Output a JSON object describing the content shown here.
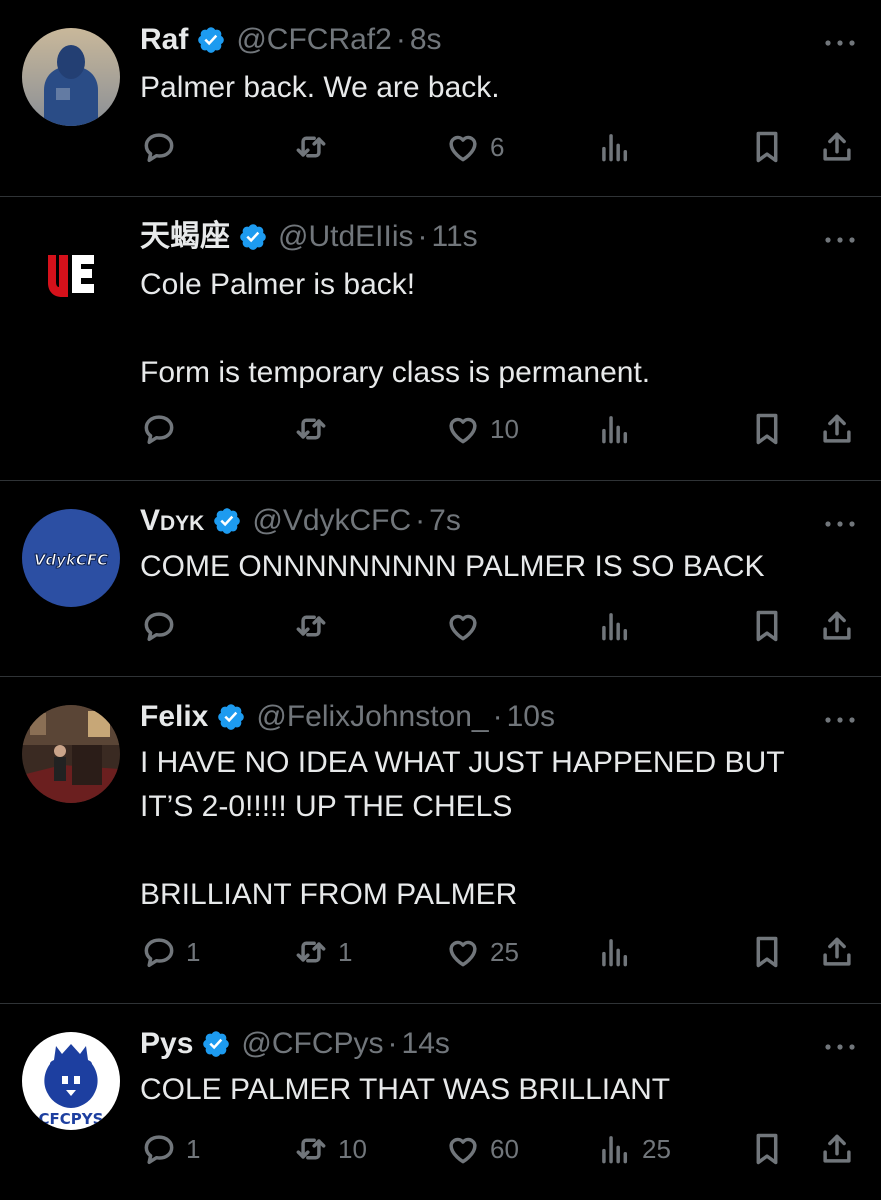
{
  "colors": {
    "background": "#000000",
    "text": "#e7e9ea",
    "muted": "#71767b",
    "verified": "#1d9bf0",
    "divider": "#2f3336"
  },
  "tweets": [
    {
      "name": "Raf",
      "handle": "@CFCRaf2",
      "sep": "·",
      "time": "8s",
      "text": "Palmer back. We are back.",
      "replies": "",
      "reposts": "",
      "likes": "6",
      "views": ""
    },
    {
      "name": "天蝎座",
      "handle": "@UtdEIIis",
      "sep": "·",
      "time": "11s",
      "text": "Cole Palmer is back!\n\nForm is temporary class is permanent.",
      "replies": "",
      "reposts": "",
      "likes": "10",
      "views": ""
    },
    {
      "name": "Vdyk",
      "handle": "@VdykCFC",
      "sep": "·",
      "time": "7s",
      "avatar_text": "VdykCFC",
      "text": "COME ONNNNNNNNN PALMER IS SO BACK",
      "replies": "",
      "reposts": "",
      "likes": "",
      "views": ""
    },
    {
      "name": "Felix",
      "handle": "@FelixJohnston_",
      "sep": "·",
      "time": "10s",
      "text": "I HAVE NO IDEA WHAT JUST HAPPENED BUT\nIT’S 2-0!!!!! UP THE CHELS\n\nBRILLIANT FROM PALMER",
      "replies": "1",
      "reposts": "1",
      "likes": "25",
      "views": ""
    },
    {
      "name": "Pys",
      "handle": "@CFCPys",
      "sep": "·",
      "time": "14s",
      "avatar_text": "CFCPYS",
      "text": "COLE PALMER THAT WAS BRILLIANT",
      "replies": "1",
      "reposts": "10",
      "likes": "60",
      "views": "25"
    }
  ]
}
